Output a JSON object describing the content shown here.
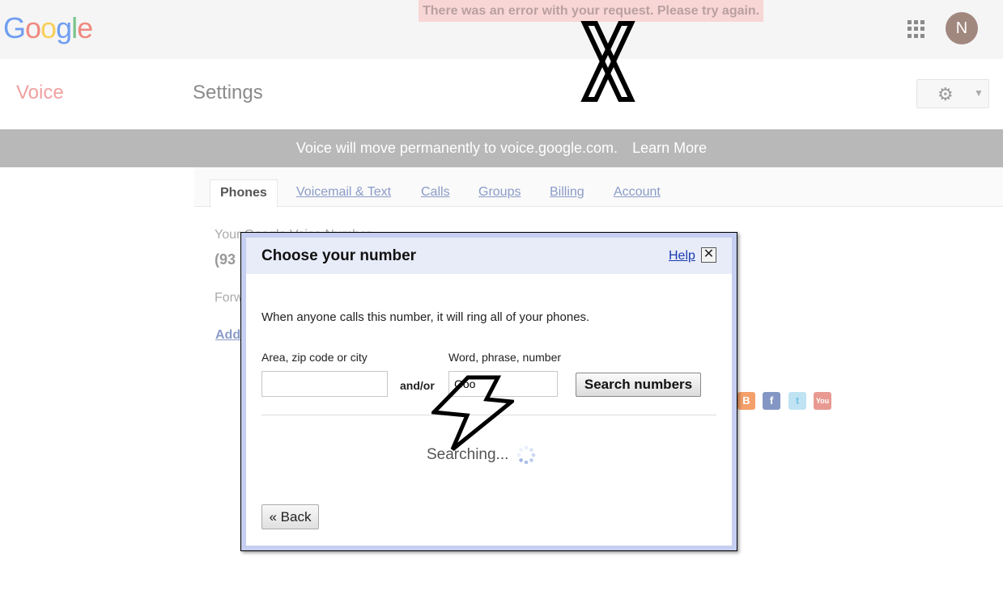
{
  "header": {
    "logo_letters": [
      {
        "ch": "G",
        "color": "#6f9ef2"
      },
      {
        "ch": "o",
        "color": "#ef8a80"
      },
      {
        "ch": "o",
        "color": "#f7cf5a"
      },
      {
        "ch": "g",
        "color": "#6f9ef2"
      },
      {
        "ch": "l",
        "color": "#78c48a"
      },
      {
        "ch": "e",
        "color": "#ef8a80"
      }
    ],
    "error_message": "There was an error with your request. Please try again.",
    "apps_icon": "apps-grid-icon",
    "avatar_initial": "N"
  },
  "subheader": {
    "product": "Voice",
    "page_title": "Settings",
    "gear_icon": "gear-icon"
  },
  "migration_banner": {
    "message": "Voice will move permanently to voice.google.com.",
    "link": "Learn More"
  },
  "tabs": [
    {
      "label": "Phones",
      "active": true
    },
    {
      "label": "Voicemail & Text",
      "active": false
    },
    {
      "label": "Calls",
      "active": false
    },
    {
      "label": "Groups",
      "active": false
    },
    {
      "label": "Billing",
      "active": false
    },
    {
      "label": "Account",
      "active": false
    }
  ],
  "background_content": {
    "number_label": "Your Google Voice Number",
    "number_partial": "(93",
    "forward_label": "Forw",
    "add_link": "Add"
  },
  "social_icons": [
    "blogger-icon",
    "facebook-icon",
    "twitter-icon",
    "youtube-icon"
  ],
  "dialog": {
    "title": "Choose your number",
    "help": "Help",
    "close": "✕",
    "description": "When anyone calls this number, it will ring all of your phones.",
    "area_label": "Area, zip code or city",
    "area_value": "",
    "word_label": "Word, phrase, number",
    "word_value": "Goo",
    "andor": "and/or",
    "search_button": "Search numbers",
    "status": "Searching...",
    "back_button": "« Back"
  }
}
